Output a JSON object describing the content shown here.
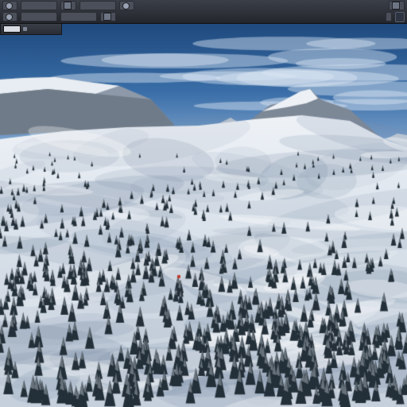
{
  "window": {
    "brand_label": ""
  },
  "toolbar": {
    "row1_items": [
      "",
      "",
      "",
      "",
      "",
      ""
    ],
    "row2_items": [
      "",
      "",
      "",
      "",
      ""
    ]
  },
  "viewport": {
    "scene": "snowy-mountain-forest-terrain",
    "sky_color": "#2e5f95",
    "snow_color": "#dfe6ef",
    "tree_color": "#2b333d"
  },
  "icons": [
    "toolbar-button-icon",
    "color-swatch-icon",
    "marker-icon"
  ]
}
